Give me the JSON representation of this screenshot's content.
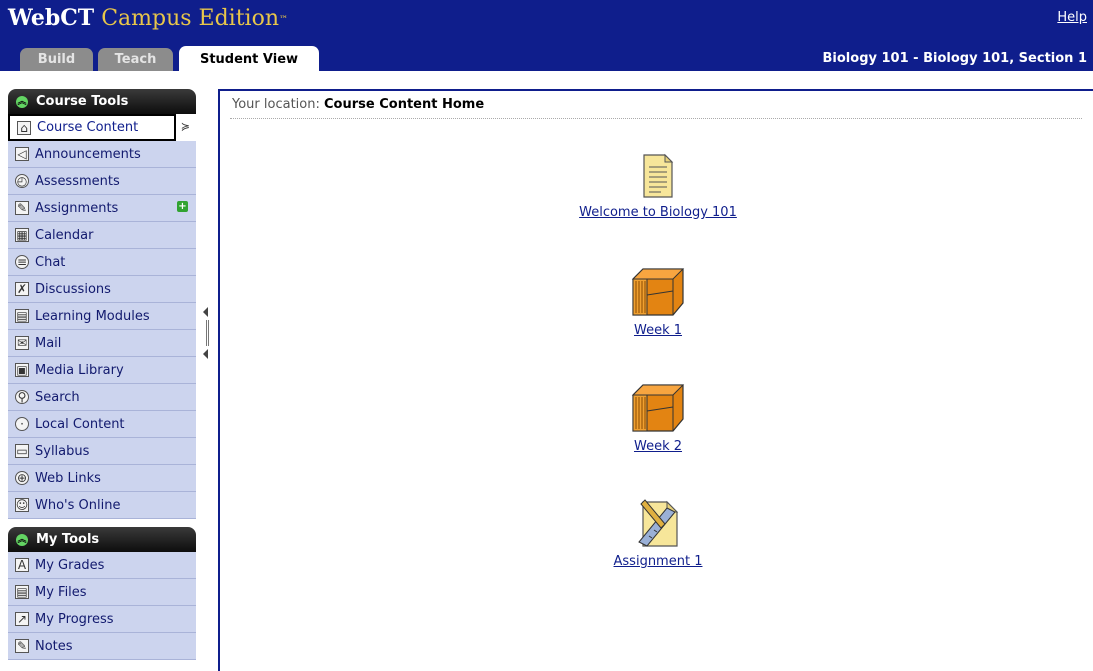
{
  "header": {
    "brand": "WebCT",
    "edition": "Campus Edition",
    "trademark": "™",
    "help_link": "Help",
    "course_title": "Biology 101 - Biology 101, Section 1",
    "tabs": [
      {
        "label": "Build",
        "active": false
      },
      {
        "label": "Teach",
        "active": false
      },
      {
        "label": "Student View",
        "active": true
      }
    ],
    "colors": {
      "header_bg": "#0f1e8c",
      "edition_gold": "#e8c64a"
    }
  },
  "sidebar": {
    "course_tools": {
      "title": "Course Tools",
      "items": [
        {
          "label": "Course Content",
          "icon": "home-icon",
          "active": true
        },
        {
          "label": "Announcements",
          "icon": "megaphone-icon"
        },
        {
          "label": "Assessments",
          "icon": "stopwatch-icon"
        },
        {
          "label": "Assignments",
          "icon": "pencil-paper-icon",
          "badge": "new"
        },
        {
          "label": "Calendar",
          "icon": "calendar-icon"
        },
        {
          "label": "Chat",
          "icon": "chat-bubble-icon"
        },
        {
          "label": "Discussions",
          "icon": "pushpin-icon"
        },
        {
          "label": "Learning Modules",
          "icon": "document-stack-icon"
        },
        {
          "label": "Mail",
          "icon": "envelope-icon"
        },
        {
          "label": "Media Library",
          "icon": "media-library-icon"
        },
        {
          "label": "Search",
          "icon": "magnifier-icon"
        },
        {
          "label": "Local Content",
          "icon": "disc-icon"
        },
        {
          "label": "Syllabus",
          "icon": "book-icon"
        },
        {
          "label": "Web Links",
          "icon": "globe-link-icon"
        },
        {
          "label": "Who's Online",
          "icon": "person-icon"
        }
      ]
    },
    "my_tools": {
      "title": "My Tools",
      "items": [
        {
          "label": "My Grades",
          "icon": "grade-icon"
        },
        {
          "label": "My Files",
          "icon": "files-icon"
        },
        {
          "label": "My Progress",
          "icon": "progress-chart-icon"
        },
        {
          "label": "Notes",
          "icon": "notes-icon"
        }
      ]
    }
  },
  "content": {
    "location_prefix": "Your location:",
    "location": "Course Content Home",
    "items": [
      {
        "label": "Welcome to Biology 101",
        "icon": "document-icon"
      },
      {
        "label": "Week 1",
        "icon": "folder-chest-icon"
      },
      {
        "label": "Week 2",
        "icon": "folder-chest-icon"
      },
      {
        "label": "Assignment 1",
        "icon": "assignment-icon"
      }
    ]
  }
}
